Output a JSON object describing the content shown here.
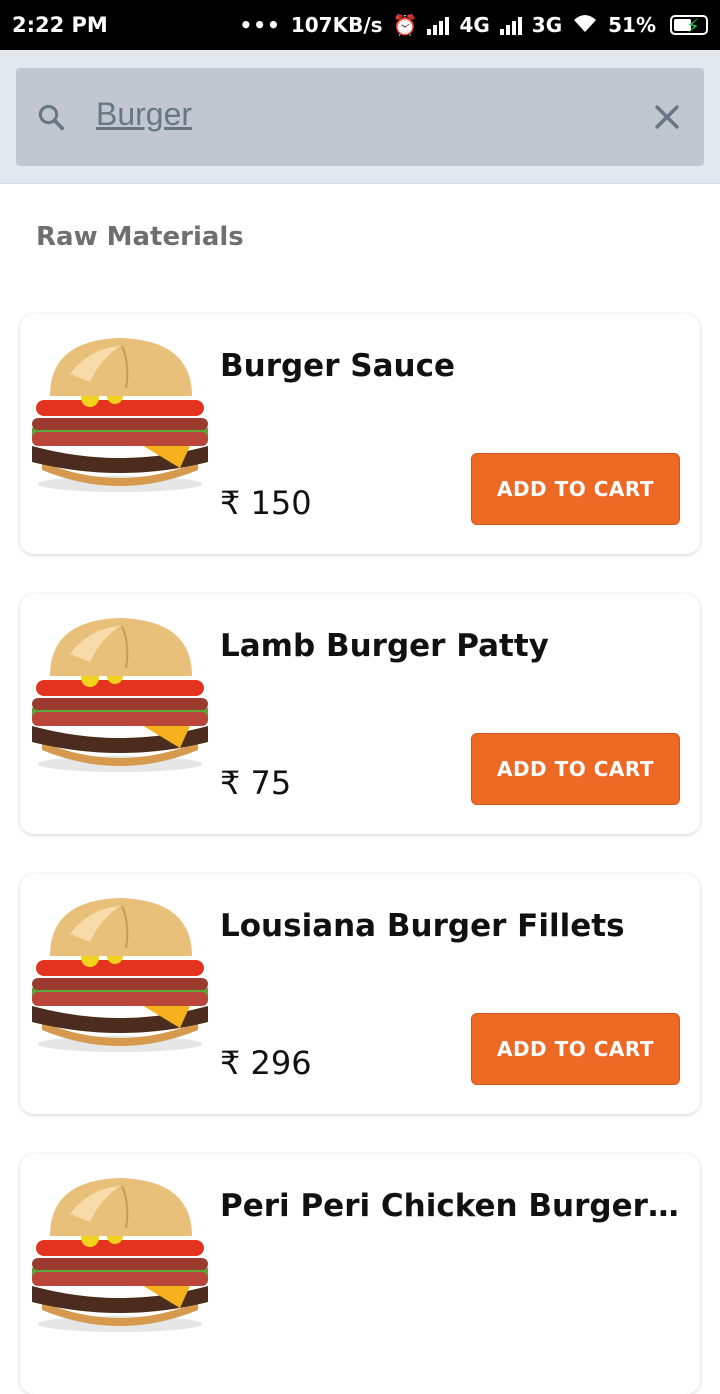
{
  "status_bar": {
    "time": "2:22 PM",
    "dots": "•••",
    "speed": "107KB/s",
    "net1": "4G",
    "net2": "3G",
    "battery": "51%"
  },
  "search": {
    "query": "Burger"
  },
  "section": {
    "title": "Raw Materials"
  },
  "products": [
    {
      "name": "Burger Sauce",
      "price": "₹ 150",
      "button": "ADD TO CART"
    },
    {
      "name": "Lamb Burger Patty",
      "price": "₹ 75",
      "button": "ADD TO CART"
    },
    {
      "name": "Lousiana Burger Fillets",
      "price": "₹ 296",
      "button": "ADD TO CART"
    },
    {
      "name": "Peri Peri Chicken Burger F...",
      "price": "",
      "button": ""
    }
  ],
  "colors": {
    "accent": "#ee6a24",
    "search_bg": "#c0c7d0",
    "header_bg": "#e3e8ee"
  }
}
